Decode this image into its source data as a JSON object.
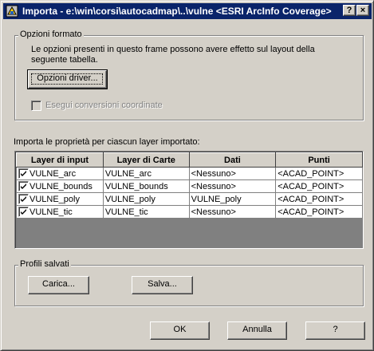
{
  "window": {
    "title": "Importa - e:\\win\\corsi\\autocadmap\\..\\vulne <ESRI ArcInfo Coverage>",
    "help_glyph": "?",
    "close_glyph": "×"
  },
  "format_options": {
    "group_label": "Opzioni formato",
    "description_line1": "Le opzioni presenti in questo frame possono avere effetto sul layout della",
    "description_line2": "seguente tabella.",
    "driver_button": "Opzioni driver...",
    "coord_checkbox_label": "Esegui conversioni coordinate",
    "coord_checkbox_checked": false,
    "coord_checkbox_enabled": false
  },
  "layers": {
    "intro_label": "Importa le proprietà per ciascun layer importato:",
    "columns": [
      "Layer di input",
      "Layer di Carte",
      "Dati",
      "Punti"
    ],
    "rows": [
      {
        "checked": true,
        "input": "VULNE_arc",
        "carte": "VULNE_arc",
        "dati": "<Nessuno>",
        "punti": "<ACAD_POINT>"
      },
      {
        "checked": true,
        "input": "VULNE_bounds",
        "carte": "VULNE_bounds",
        "dati": "<Nessuno>",
        "punti": "<ACAD_POINT>"
      },
      {
        "checked": true,
        "input": "VULNE_poly",
        "carte": "VULNE_poly",
        "dati": "VULNE_poly",
        "punti": "<ACAD_POINT>"
      },
      {
        "checked": true,
        "input": "VULNE_tic",
        "carte": "VULNE_tic",
        "dati": "<Nessuno>",
        "punti": "<ACAD_POINT>"
      }
    ]
  },
  "saved_profiles": {
    "group_label": "Profili salvati",
    "load_button": "Carica...",
    "save_button": "Salva..."
  },
  "footer": {
    "ok_button": "OK",
    "cancel_button": "Annulla",
    "help_button": "?"
  }
}
